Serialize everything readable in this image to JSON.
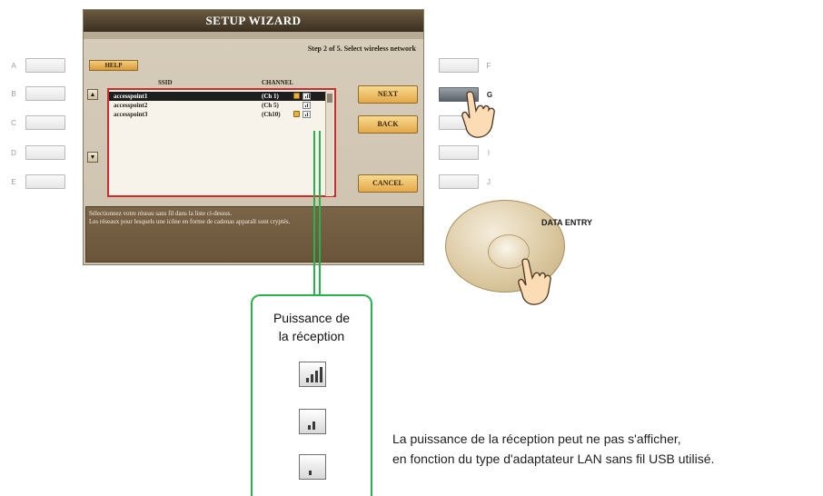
{
  "screen": {
    "title": "SETUP WIZARD",
    "step": "Step 2 of 5. Select wireless network",
    "help_label": "HELP",
    "columns": {
      "ssid": "SSID",
      "channel": "CHANNEL"
    },
    "networks": [
      {
        "ssid": "accesspoint1",
        "channel": "(Ch 1)",
        "locked": true,
        "selected": true
      },
      {
        "ssid": "accesspoint2",
        "channel": "(Ch 5)",
        "locked": false,
        "selected": false
      },
      {
        "ssid": "accesspoint3",
        "channel": "(Ch10)",
        "locked": true,
        "selected": false
      }
    ],
    "buttons": {
      "next": "NEXT",
      "back": "BACK",
      "cancel": "CANCEL"
    },
    "message_line1": "Sélectionnez votre réseau sans fil dans la liste ci-dessus.",
    "message_line2": "Les réseaux pour lesquels une icône en forme de cadenas apparaît sont cryptés."
  },
  "left_buttons": [
    "A",
    "B",
    "C",
    "D",
    "E"
  ],
  "right_buttons": [
    "F",
    "G",
    "H",
    "I",
    "J"
  ],
  "dial_label": "DATA ENTRY",
  "callout": {
    "title_line1": "Puissance de",
    "title_line2": "la réception",
    "levels": [
      "strong",
      "medium",
      "weak"
    ]
  },
  "note_line1": "La puissance de la réception peut ne pas s'afficher,",
  "note_line2": "en fonction du type d'adaptateur LAN sans fil USB utilisé.",
  "colors": {
    "accent_green": "#28b24b",
    "list_border": "#d02a2a",
    "button_gold": "#e3a84a"
  }
}
